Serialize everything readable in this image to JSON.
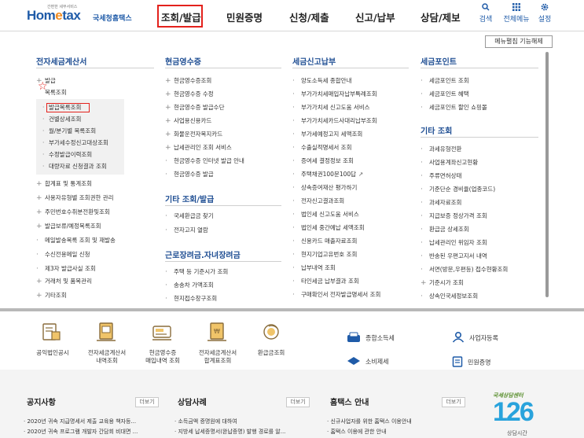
{
  "header": {
    "logo_main": "Hometax",
    "logo_e": "e",
    "logo_sub": "국세청홈택스",
    "logo_tag": "간편한 세무서비스",
    "nav": [
      "조회/발급",
      "민원증명",
      "신청/제출",
      "신고/납부",
      "상담/제보"
    ],
    "utils": [
      {
        "icon": "search-icon",
        "label": "검색"
      },
      {
        "icon": "menu-grid-icon",
        "label": "전체메뉴"
      },
      {
        "icon": "gear-icon",
        "label": "설정"
      }
    ]
  },
  "menu_toggle": "메뉴펼침 기능해제",
  "columns": {
    "c1": {
      "title": "전자세금계산서",
      "top": [
        "발급",
        "목록조회"
      ],
      "sub": [
        "발급목록조회",
        "건별상세조회",
        "월/분기별 목록조회",
        "부가세수정신고대상조회",
        "수정발급이력조회",
        "대량자료 신청결과 조회"
      ],
      "rest": [
        "합계표 및 통계조회",
        "사용자유형별 조회권한 관리",
        "주민번호수취분전환및조회",
        "발급보류/예정목록조회",
        "메일발송목록 조회 및 재발송",
        "수신전용메일 신청",
        "제3자 발급사실 조회",
        "거래처 및 품목관리",
        "기타조회"
      ]
    },
    "c2": {
      "title": "현금영수증",
      "items": [
        "현금영수증조회",
        "현금영수증 수정",
        "현금영수증 발급수단",
        "사업용신용카드",
        "화물운전자복지카드",
        "납세관리인 조회 서비스",
        "현금영수증 인터넷 발급 안내",
        "현금영수증 발급"
      ],
      "title2": "기타 조회/발급",
      "items2": [
        "국세환급금 찾기",
        "전자고지 열람"
      ],
      "title3": "근로장려금.자녀장려금",
      "items3": [
        "주택 등 기준시가 조회",
        "송송차 가액조회",
        "현지접수창구조회"
      ]
    },
    "c3": {
      "title": "세금신고납부",
      "items": [
        "양도소득세 종합안내",
        "부가가치세매입자납부특례조회",
        "부가가치세 신고도움 서비스",
        "부가가치세카드사대리납부조회",
        "부가세예정고지 세액조회",
        "수출실적명세서 조회",
        "증여세 결정정보 조회",
        "주택채권100문100답",
        "상속증여재산 평가하기",
        "전자신고결과조회",
        "법인세 신고도움 서비스",
        "법인세 중간예납 세액조회",
        "신용카드 매출자료조회",
        "현지기업고유번호 조회",
        "납부내역 조회",
        "타인세금 납부결과 조회",
        "구매확인서 전자발급명세서 조회"
      ]
    },
    "c4": {
      "title": "세금포인트",
      "items": [
        "세금포인트 조회",
        "세금포인트 혜택",
        "세금포인트 할인 쇼핑몰"
      ],
      "title2": "기타 조회",
      "items2": [
        "과세유형전환",
        "사업용계좌신고현황",
        "주류면허상태",
        "기준단순 경비율(업종코드)",
        "과세자료조회",
        "지급보증 정상가격 조회",
        "환급금 상세조회",
        "납세관리인 위임자 조회",
        "반송된 우편고지서 내역",
        "서면(방문,우편등) 접수현황조회",
        "기준시가 조회",
        "상속인국세정보조회"
      ]
    }
  },
  "quick_icons": [
    {
      "icon": "public-company-icon",
      "label": "공익법인공시"
    },
    {
      "icon": "invoice-list-icon",
      "label": "전자세금계산서\n내역조회"
    },
    {
      "icon": "receipt-list-icon",
      "label": "현금영수증\n매입내역 조회"
    },
    {
      "icon": "invoice-sum-icon",
      "label": "전자세금계산서\n합계표조회"
    },
    {
      "icon": "refund-icon",
      "label": "환급금조회"
    }
  ],
  "quick_links": [
    {
      "icon": "income-tax-icon",
      "label": "종합소득세"
    },
    {
      "icon": "business-register-icon",
      "label": "사업자등록"
    },
    {
      "icon": "consumption-tax-icon",
      "label": "소비제세"
    },
    {
      "icon": "certificate-icon",
      "label": "민원증명"
    }
  ],
  "bottom": {
    "notice_title": "공지사항",
    "notice_more": "더보기",
    "notice_items": [
      "2020년 귀속 지급명세서 제출 교육용 책자등...",
      "2020년 귀속 프로그램 개발자 간담회 비대면 ..."
    ],
    "consult_title": "상담사례",
    "consult_more": "더보기",
    "consult_items": [
      "소득금액 증명원에 대하여",
      "지방세 납세증명서(완납증명) 발행 경로를 알..."
    ],
    "guide_title": "홈택스 안내",
    "guide_more": "더보기",
    "guide_items": [
      "신규사업자를 위한 홈택스 이용안내",
      "홈택스 이용에 관한 안내"
    ],
    "banner_top": "국세상담센터",
    "banner_num": "126",
    "banner_bottom": "상담시간"
  },
  "colors": {
    "brand": "#1f5ba8",
    "accent": "#e3211c",
    "orange": "#f18b1f"
  }
}
